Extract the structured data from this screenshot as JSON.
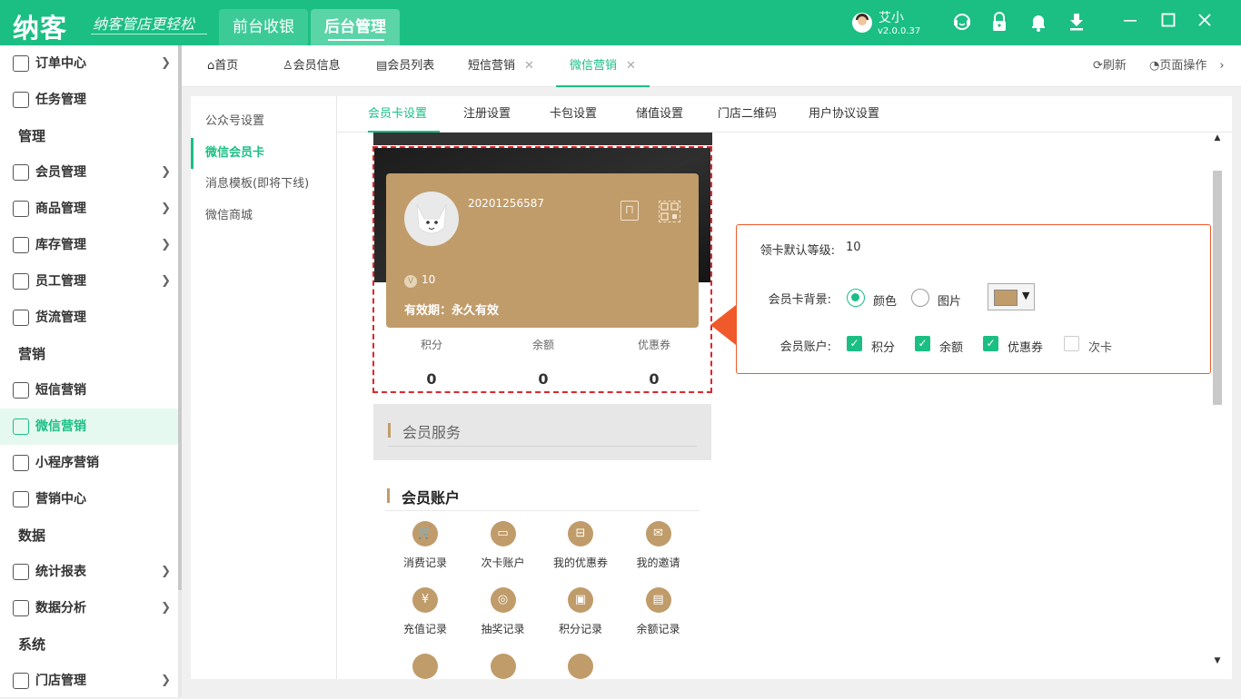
{
  "app": {
    "logo": "纳客",
    "slogan": "纳客管店更轻松",
    "nav": [
      "前台收银",
      "后台管理"
    ],
    "user_name": "艾小",
    "version": "v2.0.0.37",
    "icons": [
      "headset-icon",
      "lock-icon",
      "bell-icon",
      "download-icon",
      "minimize-icon",
      "maximize-icon",
      "close-icon"
    ]
  },
  "sidebar": {
    "items": [
      {
        "label": "订单中心",
        "type": "item",
        "icon": "globe-icon",
        "arrow": true
      },
      {
        "label": "任务管理",
        "type": "item",
        "icon": "task-icon",
        "arrow": false
      },
      {
        "label": "管理",
        "type": "section"
      },
      {
        "label": "会员管理",
        "type": "item",
        "icon": "crown-icon",
        "arrow": true
      },
      {
        "label": "商品管理",
        "type": "item",
        "icon": "product-icon",
        "arrow": true
      },
      {
        "label": "库存管理",
        "type": "item",
        "icon": "box-icon",
        "arrow": true
      },
      {
        "label": "员工管理",
        "type": "item",
        "icon": "person-icon",
        "arrow": true
      },
      {
        "label": "货流管理",
        "type": "item",
        "icon": "truck-icon",
        "arrow": false
      },
      {
        "label": "营销",
        "type": "section"
      },
      {
        "label": "短信营销",
        "type": "item",
        "icon": "mail-icon",
        "arrow": false
      },
      {
        "label": "微信营销",
        "type": "item",
        "icon": "wechat-icon",
        "arrow": false,
        "active": true
      },
      {
        "label": "小程序营销",
        "type": "item",
        "icon": "miniprogram-icon",
        "arrow": false
      },
      {
        "label": "营销中心",
        "type": "item",
        "icon": "target-icon",
        "arrow": false
      },
      {
        "label": "数据",
        "type": "section"
      },
      {
        "label": "统计报表",
        "type": "item",
        "icon": "bar-chart-icon",
        "arrow": true
      },
      {
        "label": "数据分析",
        "type": "item",
        "icon": "analysis-icon",
        "arrow": true
      },
      {
        "label": "系统",
        "type": "section"
      },
      {
        "label": "门店管理",
        "type": "item",
        "icon": "store-icon",
        "arrow": true
      }
    ]
  },
  "tabs": {
    "items": [
      {
        "label": "首页",
        "closable": false
      },
      {
        "label": "会员信息",
        "closable": false
      },
      {
        "label": "会员列表",
        "closable": false
      },
      {
        "label": "短信营销",
        "closable": true
      },
      {
        "label": "微信营销",
        "closable": true,
        "active": true
      }
    ],
    "close_glyph": "✕",
    "refresh": "刷新",
    "page_ops": "页面操作"
  },
  "subnav": {
    "items": [
      "公众号设置",
      "微信会员卡",
      "消息模板(即将下线)",
      "微信商城"
    ],
    "active": 1
  },
  "inner_tabs": {
    "items": [
      "会员卡设置",
      "注册设置",
      "卡包设置",
      "储值设置",
      "门店二维码",
      "用户协议设置"
    ],
    "active": 0
  },
  "card": {
    "number": "20201256587",
    "level": "10",
    "validity": "有效期：永久有效",
    "color": "#c09c6a",
    "stats": [
      {
        "label": "积分",
        "value": "0"
      },
      {
        "label": "余额",
        "value": "0"
      },
      {
        "label": "优惠券",
        "value": "0"
      }
    ]
  },
  "services": {
    "title": "会员服务"
  },
  "account": {
    "title": "会员账户",
    "items": [
      {
        "label": "消费记录",
        "icon": "cart-icon"
      },
      {
        "label": "次卡账户",
        "icon": "card-icon"
      },
      {
        "label": "我的优惠券",
        "icon": "coupon-icon"
      },
      {
        "label": "我的邀请",
        "icon": "invite-icon"
      },
      {
        "label": "充值记录",
        "icon": "money-bag-icon"
      },
      {
        "label": "抽奖记录",
        "icon": "wheel-icon"
      },
      {
        "label": "积分记录",
        "icon": "points-icon"
      },
      {
        "label": "余额记录",
        "icon": "balance-icon"
      }
    ]
  },
  "settings": {
    "default_level_label": "领卡默认等级:",
    "default_level_value": "10",
    "bg_label": "会员卡背景:",
    "bg_options": [
      "颜色",
      "图片"
    ],
    "bg_selected": "颜色",
    "bg_color": "#c09c6a",
    "account_label": "会员账户:",
    "account_options": [
      {
        "label": "积分",
        "checked": true
      },
      {
        "label": "余额",
        "checked": true
      },
      {
        "label": "优惠券",
        "checked": true
      },
      {
        "label": "次卡",
        "checked": false
      }
    ]
  }
}
